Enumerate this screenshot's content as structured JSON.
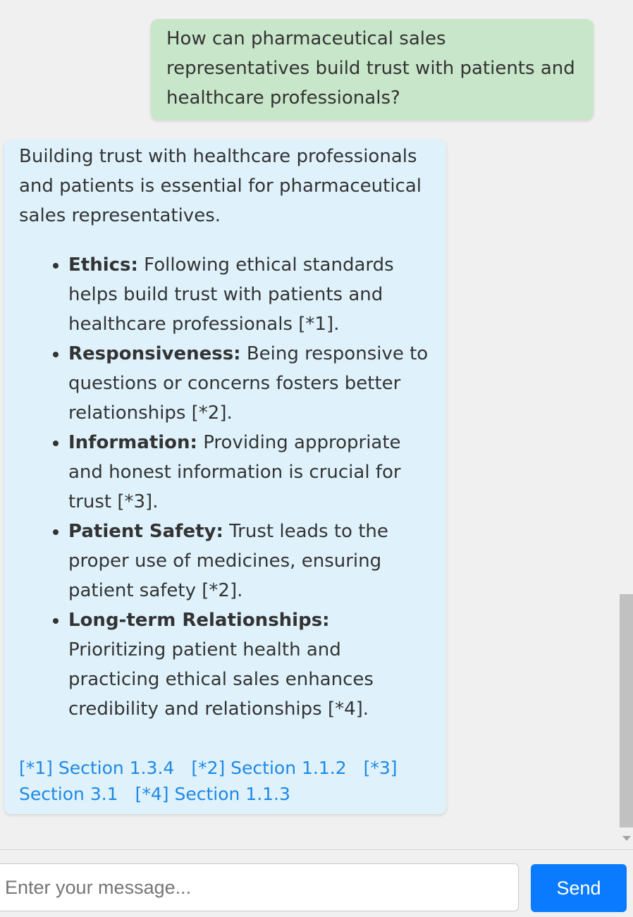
{
  "chat": {
    "user_message": "How can pharmaceutical sales representatives build trust with patients and healthcare professionals?",
    "bot_intro": "Building trust with healthcare professionals and patients is essential for pharmaceutical sales representatives.",
    "bullets": [
      {
        "title": "Ethics:",
        "text": " Following ethical standards helps build trust with patients and healthcare professionals [*1]."
      },
      {
        "title": "Responsiveness:",
        "text": " Being responsive to questions or concerns fosters better relationships [*2]."
      },
      {
        "title": "Information:",
        "text": " Providing appropriate and honest information is crucial for trust [*3]."
      },
      {
        "title": "Patient Safety:",
        "text": " Trust leads to the proper use of medicines, ensuring patient safety [*2]."
      },
      {
        "title": "Long-term Relationships:",
        "text": " Prioritizing patient health and practicing ethical sales enhances credibility and relationships [*4]."
      }
    ],
    "references": [
      "[*1] Section 1.3.4",
      "[*2] Section 1.1.2",
      "[*3] Section 3.1",
      "[*4] Section 1.1.3"
    ]
  },
  "composer": {
    "placeholder": "Enter your message...",
    "send_label": "Send"
  },
  "colors": {
    "user_bubble": "#c8e6c9",
    "bot_bubble": "#dff2fb",
    "link": "#1e88e5",
    "send_button": "#0a7bff"
  }
}
